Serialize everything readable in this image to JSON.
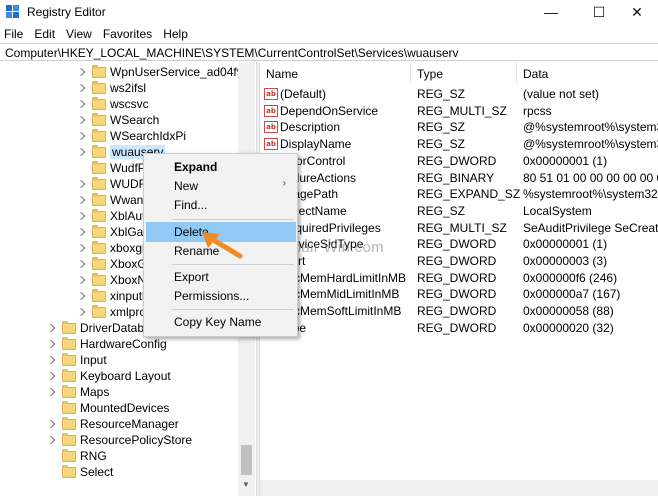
{
  "window": {
    "title": "Registry Editor",
    "minimize_glyph": "—",
    "maximize_glyph": "☐",
    "close_glyph": "✕"
  },
  "menu": [
    "File",
    "Edit",
    "View",
    "Favorites",
    "Help"
  ],
  "address": "Computer\\HKEY_LOCAL_MACHINE\\SYSTEM\\CurrentControlSet\\Services\\wuauserv",
  "tree": {
    "service_items": [
      "WpnUserService_ad04f9",
      "ws2ifsl",
      "wscsvc",
      "WSearch",
      "WSearchIdxPi",
      "wuauserv",
      "WudfPf",
      "WUDFRd",
      "WwanSvc",
      "XblAuthManager",
      "XblGameSave",
      "xboxgip",
      "XboxGipSvc",
      "XboxNetApiSvc",
      "xinputhid",
      "xmlprov"
    ],
    "control_items": [
      "DriverDatabase",
      "HardwareConfig",
      "Input",
      "Keyboard Layout",
      "Maps",
      "MountedDevices",
      "ResourceManager",
      "ResourcePolicyStore",
      "RNG",
      "Select"
    ],
    "selected": "wuauserv"
  },
  "values": {
    "headers": [
      "Name",
      "Type",
      "Data"
    ],
    "rows": [
      {
        "name": "(Default)",
        "type": "REG_SZ",
        "data": "(value not set)",
        "icon": "string-value-icon"
      },
      {
        "name": "DependOnService",
        "type": "REG_MULTI_SZ",
        "data": "rpcss",
        "icon": "string-value-icon"
      },
      {
        "name": "Description",
        "type": "REG_SZ",
        "data": "@%systemroot%\\system32\\w",
        "icon": "string-value-icon"
      },
      {
        "name": "DisplayName",
        "type": "REG_SZ",
        "data": "@%systemroot%\\system32\\w",
        "icon": "string-value-icon"
      },
      {
        "name": "ErrorControl",
        "type": "REG_DWORD",
        "data": "0x00000001 (1)",
        "icon": "binary-value-icon"
      },
      {
        "name": "FailureActions",
        "type": "REG_BINARY",
        "data": "80 51 01 00 00 00 00 00 00 0",
        "icon": "binary-value-icon"
      },
      {
        "name": "ImagePath",
        "type": "REG_EXPAND_SZ",
        "data": "%systemroot%\\system32\\svc",
        "icon": "string-value-icon"
      },
      {
        "name": "ObjectName",
        "type": "REG_SZ",
        "data": "LocalSystem",
        "icon": "string-value-icon"
      },
      {
        "name": "RequiredPrivileges",
        "type": "REG_MULTI_SZ",
        "data": "SeAuditPrivilege SeCreateGlo",
        "icon": "string-value-icon"
      },
      {
        "name": "ServiceSidType",
        "type": "REG_DWORD",
        "data": "0x00000001 (1)",
        "icon": "binary-value-icon"
      },
      {
        "name": "Start",
        "type": "REG_DWORD",
        "data": "0x00000003 (3)",
        "icon": "binary-value-icon"
      },
      {
        "name": "SvcMemHardLimitInMB",
        "type": "REG_DWORD",
        "data": "0x000000f6 (246)",
        "icon": "binary-value-icon"
      },
      {
        "name": "SvcMemMidLimitInMB",
        "type": "REG_DWORD",
        "data": "0x000000a7 (167)",
        "icon": "binary-value-icon"
      },
      {
        "name": "SvcMemSoftLimitInMB",
        "type": "REG_DWORD",
        "data": "0x00000058 (88)",
        "icon": "binary-value-icon"
      },
      {
        "name": "Type",
        "type": "REG_DWORD",
        "data": "0x00000020 (32)",
        "icon": "binary-value-icon"
      }
    ]
  },
  "context_menu": {
    "items": [
      {
        "label": "Expand",
        "bold": true
      },
      {
        "label": "New",
        "submenu": true
      },
      {
        "label": "Find..."
      },
      {
        "label": "Delete",
        "highlighted": true
      },
      {
        "label": "Rename"
      },
      {
        "label": "Export"
      },
      {
        "label": "Permissions..."
      },
      {
        "label": "Copy Key Name"
      }
    ],
    "submenu_glyph": "›"
  },
  "watermark": "Repair Win.com",
  "colors": {
    "highlight": "#91c9f7",
    "selected_tree": "#cce8ff",
    "annotation_arrow": "#f08a24",
    "folder": "#f6d77b"
  }
}
